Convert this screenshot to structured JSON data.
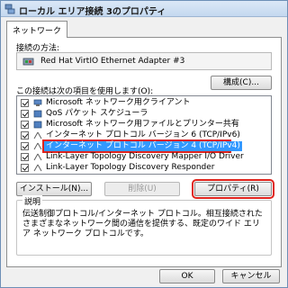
{
  "window": {
    "title": "ローカル エリア接続 3のプロパティ"
  },
  "tabs": [
    {
      "label": "ネットワーク"
    }
  ],
  "connect_using": {
    "label": "接続の方法:",
    "adapter_name": "Red Hat VirtIO Ethernet Adapter #3",
    "configure_button": "構成(C)..."
  },
  "items_section": {
    "label": "この接続は次の項目を使用します(O):",
    "items": [
      {
        "label": "Microsoft ネットワーク用クライアント",
        "checked": true,
        "icon": "network-client-icon"
      },
      {
        "label": "QoS パケット スケジューラ",
        "checked": true,
        "icon": "service-icon"
      },
      {
        "label": "Microsoft ネットワーク用ファイルとプリンター共有",
        "checked": true,
        "icon": "service-icon"
      },
      {
        "label": "インターネット プロトコル バージョン 6 (TCP/IPv6)",
        "checked": true,
        "icon": "protocol-icon"
      },
      {
        "label": "インターネット プロトコル バージョン 4 (TCP/IPv4)",
        "checked": true,
        "icon": "protocol-icon",
        "selected": true
      },
      {
        "label": "Link-Layer Topology Discovery Mapper I/O Driver",
        "checked": true,
        "icon": "protocol-icon"
      },
      {
        "label": "Link-Layer Topology Discovery Responder",
        "checked": true,
        "icon": "protocol-icon"
      }
    ]
  },
  "buttons": {
    "install": "インストール(N)...",
    "uninstall": "削除(U)",
    "properties": "プロパティ(R)",
    "ok": "OK",
    "cancel": "キャンセル"
  },
  "description": {
    "title": "説明",
    "text": "伝送制御プロトコル/インターネット プロトコル。相互接続されたさまざまなネットワーク間の通信を提供する、既定のワイド エリア ネットワーク プロトコルです。"
  },
  "colors": {
    "highlight_red": "#e0231c",
    "selection_blue": "#3399ff"
  }
}
